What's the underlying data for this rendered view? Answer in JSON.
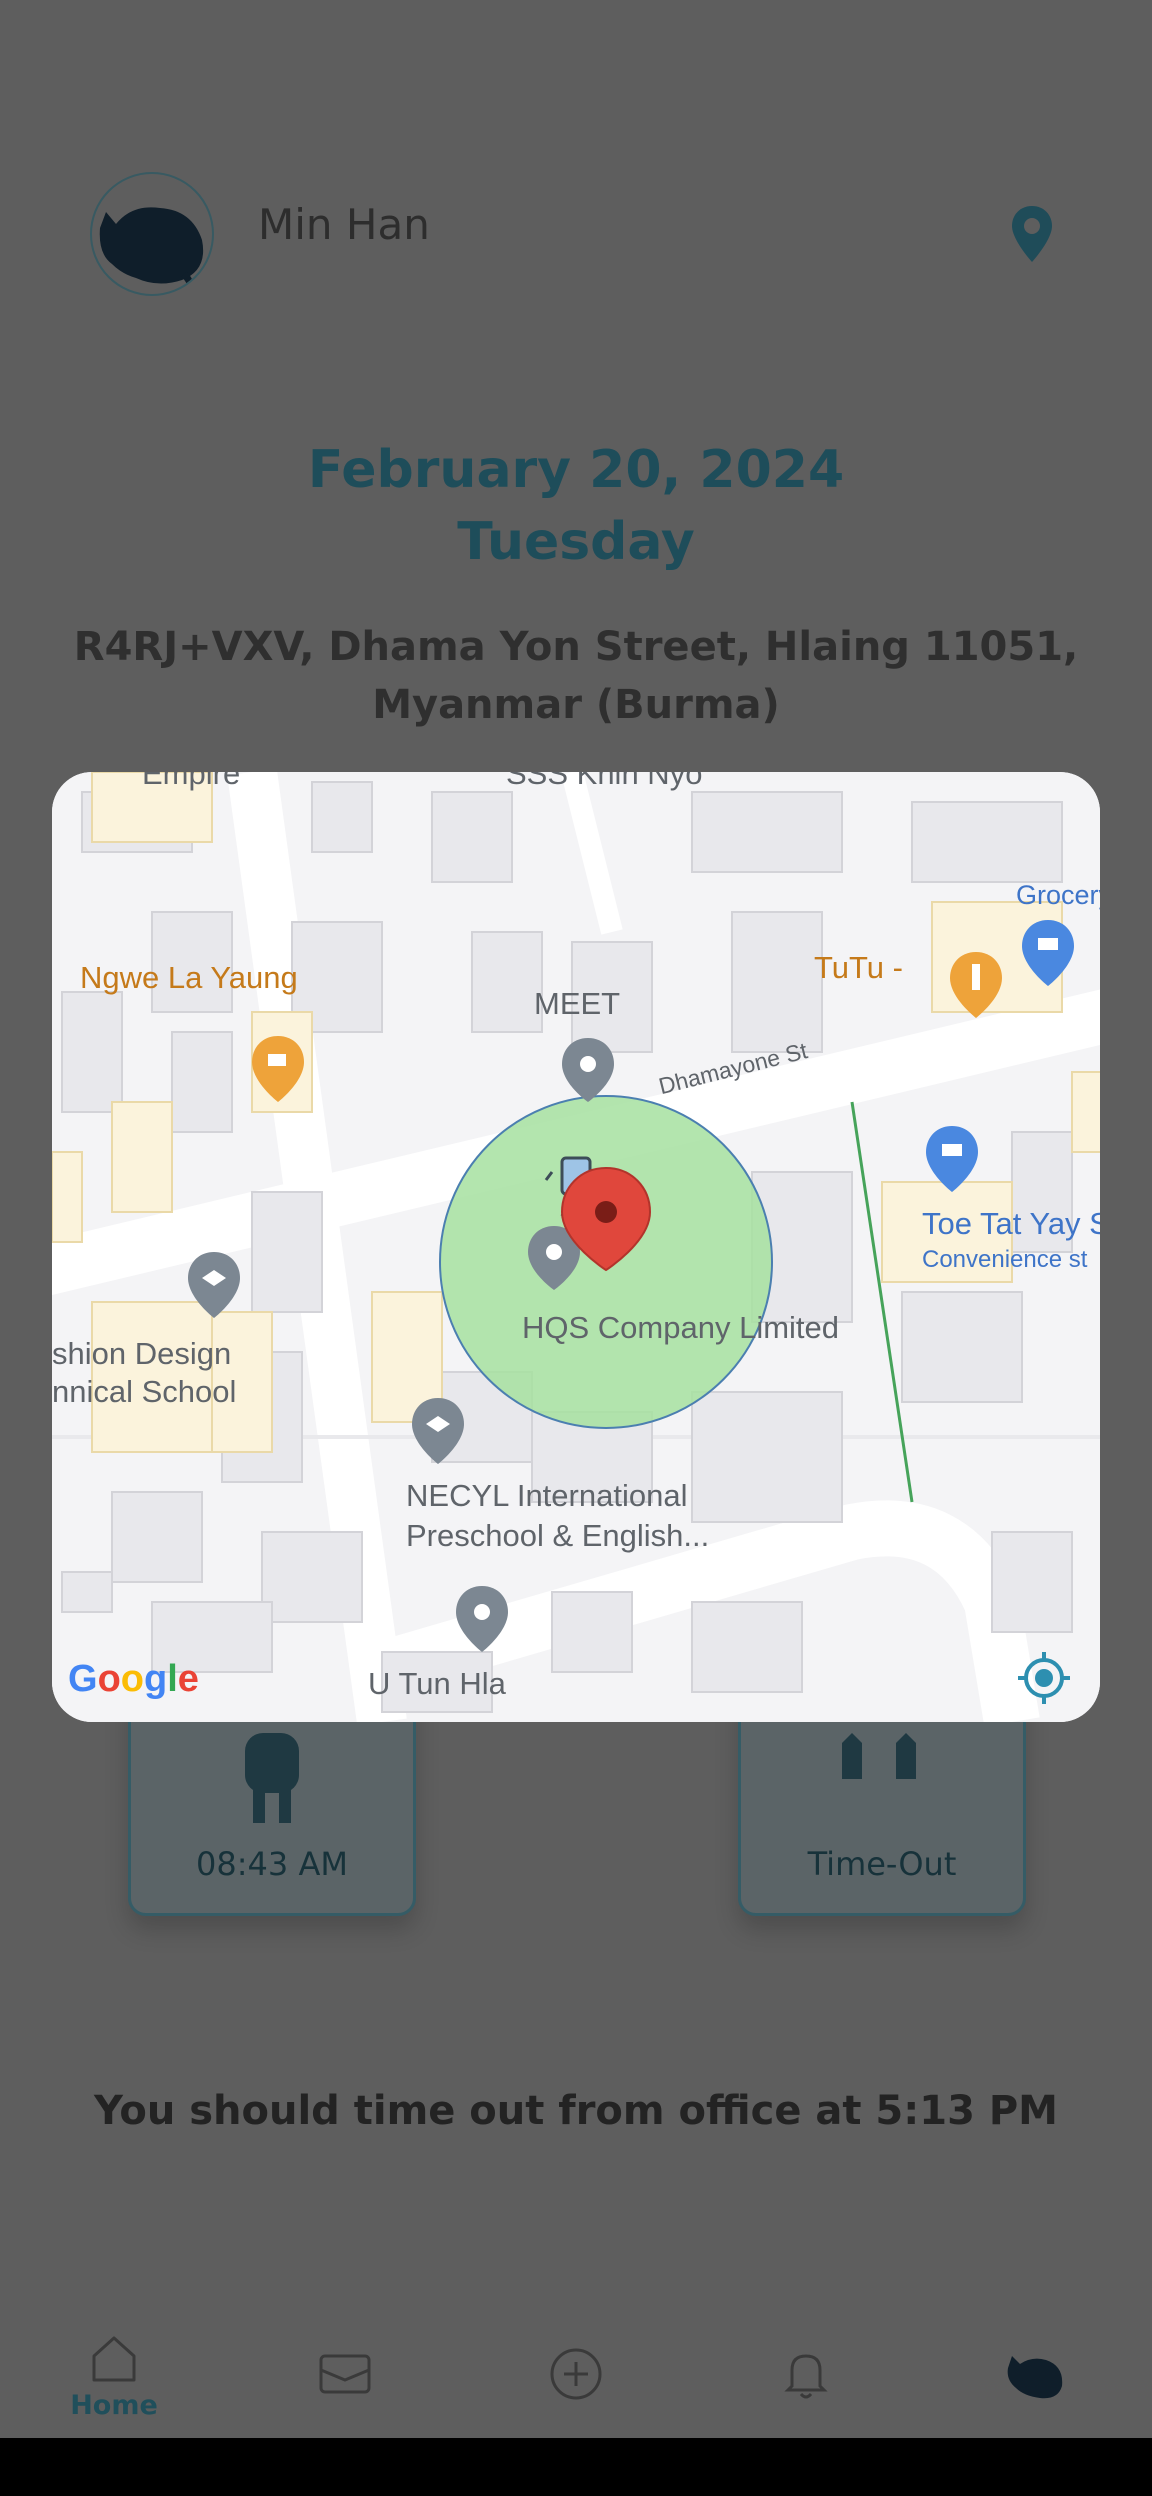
{
  "header": {
    "user_name": "Min Han"
  },
  "date": {
    "line1": "February 20, 2024",
    "line2": "Tuesday"
  },
  "address": "R4RJ+VXV, Dhama Yon Street, Hlaing 11051, Myanmar (Burma)",
  "cards": {
    "time_in": {
      "label": "08:43 AM"
    },
    "time_out": {
      "label": "Time-Out"
    }
  },
  "timeout_message": "You should time out from office at 5:13 PM",
  "nav": {
    "home_label": "Home"
  },
  "map": {
    "labels": {
      "empire": "Empire",
      "sss_khin_nyo": "SSS Khin Nyo",
      "grocery": "Grocery",
      "ngwe_la_yaung": "Ngwe La Yaung",
      "tutu": "TuTu -",
      "meet": "MEET",
      "dhamayone_st": "Dhamayone St",
      "toe_tat_yay": "Toe Tat Yay S",
      "convenience": "Convenience st",
      "fashion_1": "shion Design",
      "fashion_2": "nnical School",
      "hqs": "HQS Company Limited",
      "necyl_1": "NECYL International",
      "necyl_2": "Preschool & English...",
      "u_tun_hla": "U Tun Hla"
    },
    "logo": "Google",
    "colors": {
      "radius_fill": "#a6e0a0",
      "pin_red": "#e0473c",
      "poi_grey": "#7c8792",
      "poi_orange": "#eea33a",
      "poi_blue": "#4a88e0"
    }
  }
}
